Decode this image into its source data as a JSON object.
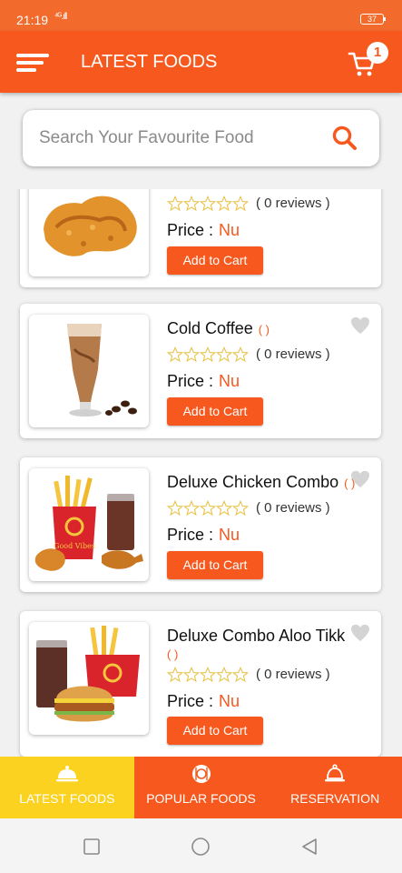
{
  "status_bar": {
    "time": "21:19",
    "signal": "⁴ᴳ.ıll",
    "battery": "37"
  },
  "header": {
    "title": "LATEST FOODS",
    "cart_count": "1"
  },
  "search": {
    "placeholder": "Search Your Favourite Food"
  },
  "foods": [
    {
      "name": "",
      "sub": "",
      "reviews": "( 0 reviews )",
      "price_label": "Price :",
      "currency": "Nu",
      "button": "Add to Cart",
      "image": "fried-chicken-wing"
    },
    {
      "name": "Cold Coffee",
      "sub": "( )",
      "reviews": "( 0 reviews )",
      "price_label": "Price :",
      "currency": "Nu",
      "button": "Add to Cart",
      "image": "cold-coffee-glass"
    },
    {
      "name": "Deluxe Chicken Combo",
      "sub": "( )",
      "reviews": "( 0 reviews )",
      "price_label": "Price :",
      "currency": "Nu",
      "button": "Add to Cart",
      "image": "chicken-combo",
      "brand": "Good Vibes"
    },
    {
      "name": "Deluxe Combo Aloo Tikk",
      "sub": "( )",
      "reviews": "( 0 reviews )",
      "price_label": "Price :",
      "currency": "Nu",
      "button": "Add to Cart",
      "image": "burger-combo"
    }
  ],
  "bottom_nav": [
    {
      "label": "LATEST FOODS",
      "icon": "cloche-icon",
      "active": true
    },
    {
      "label": "POPULAR FOODS",
      "icon": "plate-icon",
      "active": false
    },
    {
      "label": "RESERVATION",
      "icon": "bell-icon",
      "active": false
    }
  ],
  "colors": {
    "primary": "#f7581d",
    "active_tab": "#fbd21f",
    "star_outline": "#e8c34a"
  }
}
